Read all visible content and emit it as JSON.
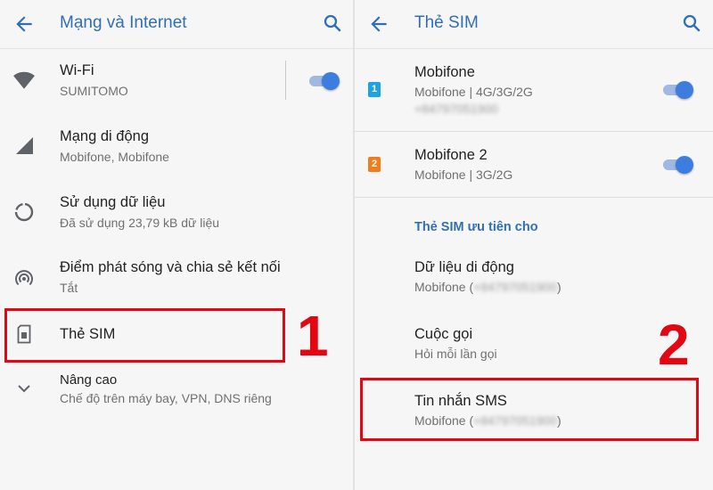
{
  "left": {
    "title": "Mạng và Internet",
    "items": [
      {
        "label": "Wi-Fi",
        "sub": "SUMITOMO",
        "icon": "wifi-icon"
      },
      {
        "label": "Mạng di động",
        "sub": "Mobifone, Mobifone",
        "icon": "signal-icon"
      },
      {
        "label": "Sử dụng dữ liệu",
        "sub": "Đã sử dụng 23,79 kB dữ liệu",
        "icon": "data-usage-icon"
      },
      {
        "label": "Điểm phát sóng và chia sẻ kết nối",
        "sub": "Tắt",
        "icon": "hotspot-icon"
      },
      {
        "label": "Thẻ SIM",
        "icon": "sim-card-icon"
      },
      {
        "label": "Nâng cao",
        "sub": "Chế độ trên máy bay, VPN, DNS riêng",
        "icon": "chevron-down-icon"
      }
    ],
    "marker": "1",
    "wifi_enabled": true
  },
  "right": {
    "title": "Thẻ SIM",
    "sims": [
      {
        "badge": "1",
        "name": "Mobifone",
        "sub": "Mobifone | 4G/3G/2G",
        "number": "+84797051900",
        "badge_color": "#1aa3e8",
        "enabled": true
      },
      {
        "badge": "2",
        "name": "Mobifone 2",
        "sub": "Mobifone | 3G/2G",
        "badge_color": "#f07d1a",
        "enabled": true
      }
    ],
    "section": "Thẻ SIM ưu tiên cho",
    "prefs": [
      {
        "label": "Dữ liệu di động",
        "sub": "Mobifone (",
        "number": "+84797051900",
        "close": ")"
      },
      {
        "label": "Cuộc gọi",
        "sub": "Hỏi mỗi lần gọi"
      },
      {
        "label": "Tin nhắn SMS",
        "sub": "Mobifone (",
        "number": "+84797051900",
        "close": ")"
      }
    ],
    "marker": "2"
  },
  "colors": {
    "accent": "#2f6fb8",
    "toggle_on": "#3d7de0",
    "highlight": "#e30613"
  }
}
